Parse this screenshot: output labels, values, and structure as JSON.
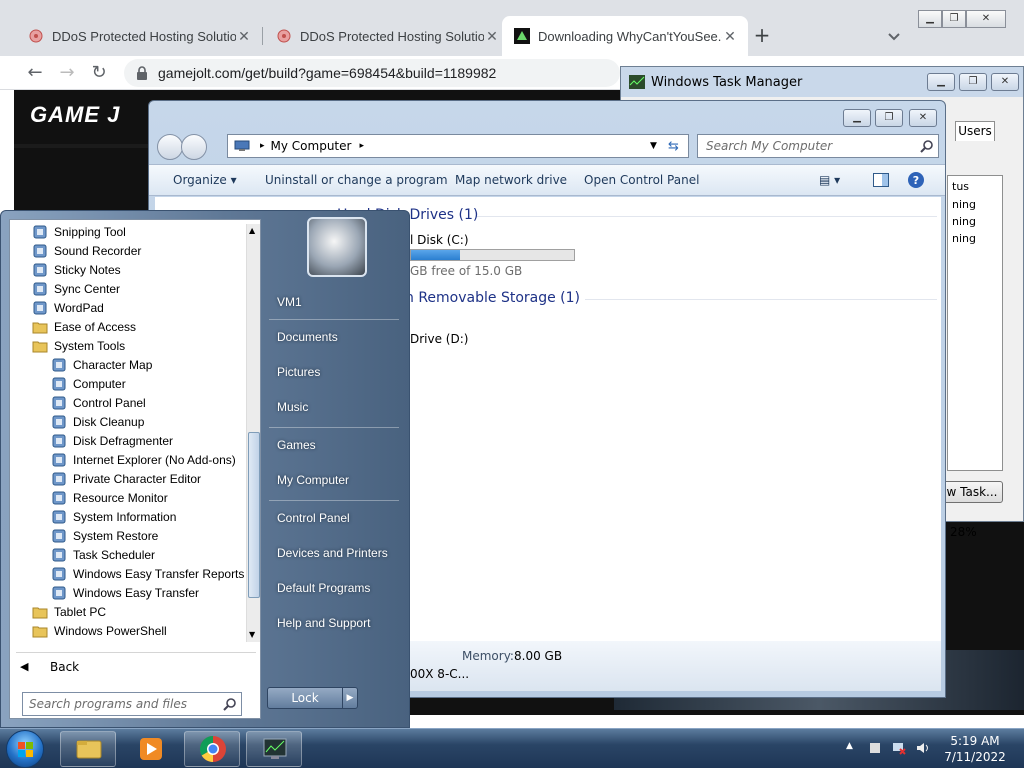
{
  "browser": {
    "tabs": [
      {
        "title": "DDoS Protected Hosting Solution"
      },
      {
        "title": "DDoS Protected Hosting Solution"
      },
      {
        "title": "Downloading WhyCan'tYouSee.exe"
      }
    ],
    "new_tab": "+",
    "url": "gamejolt.com/get/build?game=698454&build=1189982",
    "page_logo": "GAME J"
  },
  "taskmgr": {
    "title": "Windows Task Manager",
    "tab_users": "Users",
    "status_header": "tus",
    "statuses": [
      "ning",
      "ning",
      "ning"
    ],
    "new_task": "w Task...",
    "memory": "ry: 28%"
  },
  "explorer": {
    "address": "My Computer",
    "search_placeholder": "Search My Computer",
    "commands": [
      "Organize",
      "Uninstall or change a program",
      "Map network drive",
      "Open Control Panel"
    ],
    "group_hdd": "Hard Disk Drives (1)",
    "hdd_label": "l Disk (C:)",
    "hdd_free": "GB free of 15.0 GB",
    "hdd_used_fraction": 0.3,
    "group_removable": "h Removable Storage (1)",
    "removable_label": "Drive (D:)",
    "memory_label": "Memory:",
    "memory_value": "8.00 GB",
    "cpu_partial": "00X 8-C..."
  },
  "startmenu": {
    "programs": [
      {
        "label": "Snipping Tool",
        "icon": "scissors-icon",
        "indent": 1
      },
      {
        "label": "Sound Recorder",
        "icon": "microphone-icon",
        "indent": 1
      },
      {
        "label": "Sticky Notes",
        "icon": "sticky-note-icon",
        "indent": 1
      },
      {
        "label": "Sync Center",
        "icon": "sync-icon",
        "indent": 1
      },
      {
        "label": "WordPad",
        "icon": "wordpad-icon",
        "indent": 1
      },
      {
        "label": "Ease of Access",
        "icon": "folder-icon",
        "indent": 1
      },
      {
        "label": "System Tools",
        "icon": "folder-open-icon",
        "indent": 1
      },
      {
        "label": "Character Map",
        "icon": "character-map-icon",
        "indent": 2
      },
      {
        "label": "Computer",
        "icon": "computer-icon",
        "indent": 2
      },
      {
        "label": "Control Panel",
        "icon": "control-panel-icon",
        "indent": 2
      },
      {
        "label": "Disk Cleanup",
        "icon": "disk-cleanup-icon",
        "indent": 2
      },
      {
        "label": "Disk Defragmenter",
        "icon": "defrag-icon",
        "indent": 2
      },
      {
        "label": "Internet Explorer (No Add-ons)",
        "icon": "ie-icon",
        "indent": 2
      },
      {
        "label": "Private Character Editor",
        "icon": "char-editor-icon",
        "indent": 2
      },
      {
        "label": "Resource Monitor",
        "icon": "resource-monitor-icon",
        "indent": 2
      },
      {
        "label": "System Information",
        "icon": "system-info-icon",
        "indent": 2
      },
      {
        "label": "System Restore",
        "icon": "system-restore-icon",
        "indent": 2
      },
      {
        "label": "Task Scheduler",
        "icon": "clock-icon",
        "indent": 2
      },
      {
        "label": "Windows Easy Transfer Reports",
        "icon": "transfer-icon",
        "indent": 2
      },
      {
        "label": "Windows Easy Transfer",
        "icon": "transfer-icon",
        "indent": 2
      },
      {
        "label": "Tablet PC",
        "icon": "folder-icon",
        "indent": 1
      },
      {
        "label": "Windows PowerShell",
        "icon": "folder-icon",
        "indent": 1
      }
    ],
    "back": "Back",
    "search_placeholder": "Search programs and files",
    "right_items": [
      "VM1",
      "Documents",
      "Pictures",
      "Music",
      "Games",
      "My Computer",
      "Control Panel",
      "Devices and Printers",
      "Default Programs",
      "Help and Support"
    ],
    "lock": "Lock"
  },
  "taskbar": {
    "time": "5:19 AM",
    "date": "7/11/2022"
  }
}
